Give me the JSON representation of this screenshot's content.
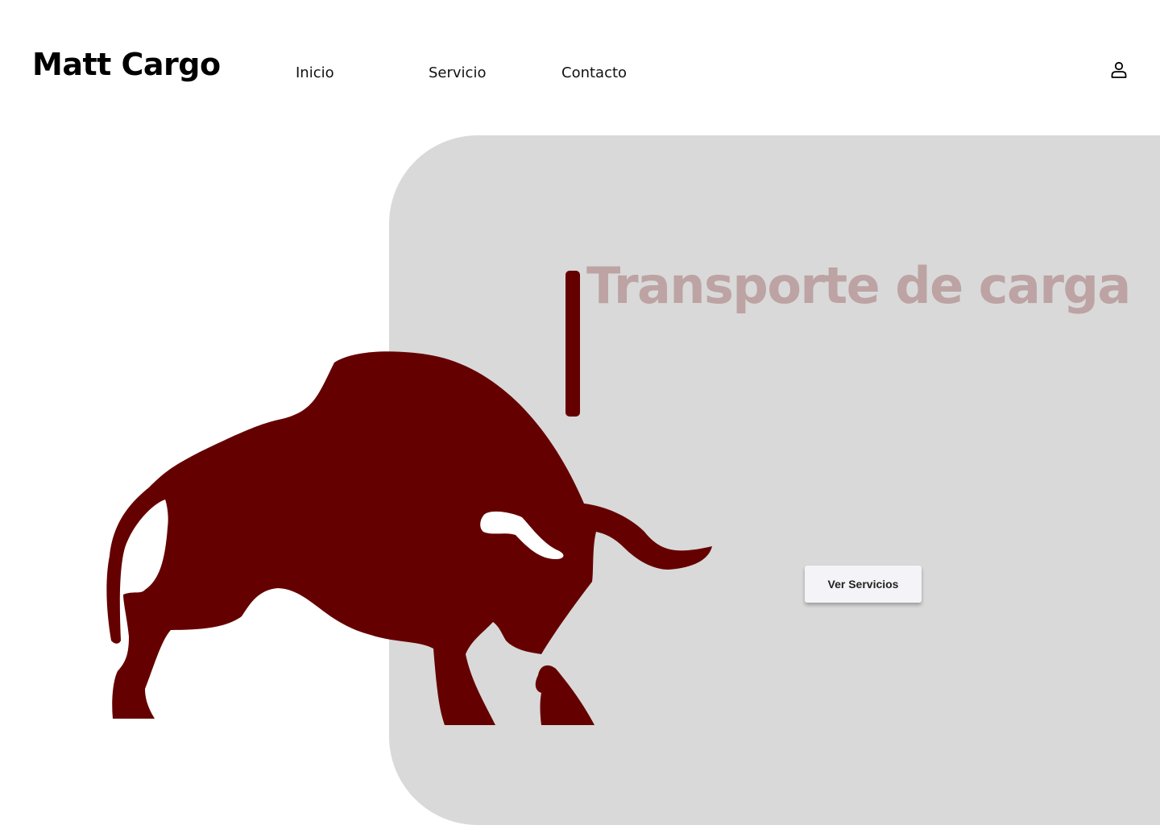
{
  "header": {
    "brand": "Matt Cargo",
    "nav": [
      {
        "label": "Inicio"
      },
      {
        "label": "Servicio"
      },
      {
        "label": "Contacto"
      }
    ],
    "user_icon": "user-icon"
  },
  "hero": {
    "title": "Transporte de carga",
    "cta_label": "Ver Servicios",
    "illustration": "bull-icon"
  },
  "colors": {
    "brand_red": "#650000",
    "title_tint": "#bda3a3",
    "panel_gray": "#d9d9d9",
    "button_bg": "#f4f4f8"
  }
}
